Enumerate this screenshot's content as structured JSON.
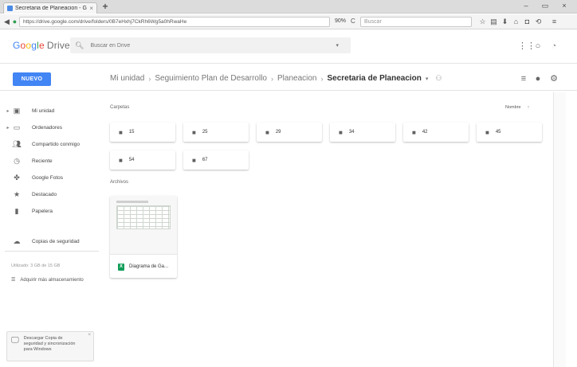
{
  "browser": {
    "tab_title": "Secretaria de Planeacion - G",
    "tab_close": "×",
    "new_tab": "+",
    "window_controls": [
      "–",
      "▭",
      "×"
    ],
    "url": "https://drive.google.com/drive/folders/0B7eHxhj7CkRh6Wg5a0hRwaHe",
    "zoom": "90%",
    "reload": "C",
    "search_placeholder": "Buscar",
    "toolbar_icons": [
      "star-icon",
      "reading-list-icon",
      "download-icon",
      "home-icon",
      "pocket-icon",
      "sync-icon",
      "menu-icon"
    ]
  },
  "drive": {
    "logo": {
      "g1": "G",
      "o1": "o",
      "o2": "o",
      "g2": "g",
      "l": "l",
      "e": "e",
      "drive": "Drive"
    },
    "search_placeholder": "Buscar en Drive",
    "header_icons": [
      "apps-icon",
      "notifications-icon",
      "account-icon"
    ]
  },
  "toolbar": {
    "new_label": "NUEVO",
    "breadcrumb": [
      "Mi unidad",
      "Seguimiento Plan de Desarrollo",
      "Planeacion",
      "Secretaria de Planeacion"
    ],
    "view_icons": [
      "list-view-icon",
      "info-icon",
      "settings-icon"
    ]
  },
  "sidebar": {
    "items": [
      {
        "label": "Mi unidad",
        "icon": "drive-icon"
      },
      {
        "label": "Ordenadores",
        "icon": "computer-icon"
      },
      {
        "label": "Compartido conmigo",
        "icon": "shared-icon"
      },
      {
        "label": "Reciente",
        "icon": "recent-icon"
      },
      {
        "label": "Google Fotos",
        "icon": "photos-icon"
      },
      {
        "label": "Destacado",
        "icon": "starred-icon"
      },
      {
        "label": "Papelera",
        "icon": "trash-icon"
      },
      {
        "label": "Copias de seguridad",
        "icon": "backup-icon"
      }
    ],
    "storage_text": "Utilizado: 3 GB de 15 GB",
    "upgrade_label": "Adquirir más almacenamiento",
    "promo_text": "Descargar Copia de seguridad y sincronización para Windows",
    "promo_close": "×"
  },
  "main": {
    "folders_title": "Carpetas",
    "sort_label": "Nombre",
    "sort_arrow": "↑",
    "folders": [
      "15",
      "25",
      "29",
      "34",
      "42",
      "45",
      "54",
      "67"
    ],
    "files_title": "Archivos",
    "file_name": "Diagrama de Ga..."
  }
}
